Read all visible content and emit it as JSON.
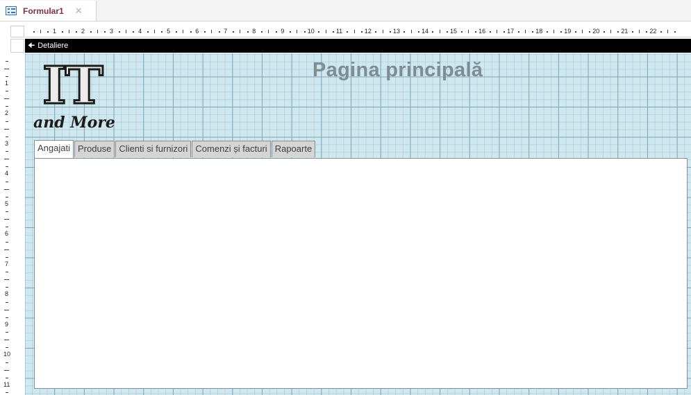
{
  "document_tab": {
    "title": "Formular1",
    "close": "✕",
    "icon": "form-icon"
  },
  "section": {
    "label": "Detaliere",
    "icon": "section-arrow-icon"
  },
  "ruler": {
    "horizontal": [
      "1",
      "2",
      "3",
      "4",
      "5",
      "6",
      "7",
      "8",
      "9",
      "10",
      "11",
      "12",
      "13",
      "14",
      "15",
      "16",
      "17",
      "18",
      "19",
      "20",
      "21",
      "22"
    ],
    "vertical": [
      "1",
      "2",
      "3",
      "4",
      "5",
      "6",
      "7",
      "8",
      "9",
      "10",
      "11"
    ]
  },
  "logo": {
    "main": "IT",
    "sub": "and More"
  },
  "page_title": "Pagina principală",
  "tabs": [
    {
      "label": "Angajati",
      "active": true
    },
    {
      "label": "Produse",
      "active": false
    },
    {
      "label": "Clienti si furnizori",
      "active": false
    },
    {
      "label": "Comenzi și facturi",
      "active": false
    },
    {
      "label": "Rapoarte",
      "active": false
    }
  ]
}
